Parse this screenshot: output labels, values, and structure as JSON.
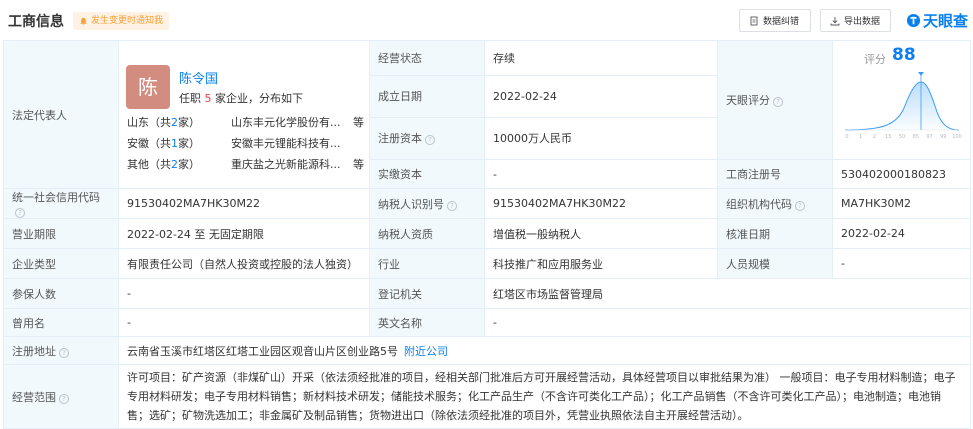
{
  "header": {
    "title": "工商信息",
    "notify_label": "发生变更时通知我",
    "error_button": "数据纠错",
    "export_button": "导出数据",
    "logo_text": "天眼查"
  },
  "rep": {
    "label": "法定代表人",
    "avatar_char": "陈",
    "name": "陈令国",
    "sub_prefix": "任职",
    "sub_count": "5",
    "sub_suffix": "家企业，分布如下",
    "groups": [
      {
        "region": "山东（共",
        "count": "2",
        "region_end": "家）",
        "company": "山东丰元化学股份有...",
        "deng": "等"
      },
      {
        "region": "安徽（共",
        "count": "1",
        "region_end": "家）",
        "company": "安徽丰元锂能科技有...",
        "deng": ""
      },
      {
        "region": "其他（共",
        "count": "2",
        "region_end": "家）",
        "company": "重庆盐之光新能源科...",
        "deng": "等"
      }
    ]
  },
  "fields": {
    "status_label": "经营状态",
    "status": "存续",
    "founded_label": "成立日期",
    "founded": "2022-02-24",
    "capital_label": "注册资本",
    "capital": "10000万人民币",
    "paid_label": "实缴资本",
    "paid": "-",
    "score_label": "天眼评分",
    "reg_no_label": "工商注册号",
    "reg_no": "530402000180823",
    "credit_label": "统一社会信用代码",
    "credit": "91530402MA7HK30M22",
    "taxpayer_id_label": "纳税人识别号",
    "taxpayer_id": "91530402MA7HK30M22",
    "org_code_label": "组织机构代码",
    "org_code": "MA7HK30M2",
    "term_label": "营业期限",
    "term": "2022-02-24  至 无固定期限",
    "tax_qual_label": "纳税人资质",
    "tax_qual": "增值税一般纳税人",
    "approve_label": "核准日期",
    "approve": "2022-02-24",
    "type_label": "企业类型",
    "type": "有限责任公司（自然人投资或控股的法人独资）",
    "industry_label": "行业",
    "industry": "科技推广和应用服务业",
    "staff_label": "人员规模",
    "staff": "-",
    "insured_label": "参保人数",
    "insured": "-",
    "authority_label": "登记机关",
    "authority": "红塔区市场监督管理局",
    "former_label": "曾用名",
    "former": "-",
    "en_name_label": "英文名称",
    "en_name": "-",
    "address_label": "注册地址",
    "address": "云南省玉溪市红塔区红塔工业园区观音山片区创业路5号",
    "nearby_link": "附近公司",
    "scope_label": "经营范围",
    "scope": "许可项目：矿产资源（非煤矿山）开采（依法须经批准的项目，经相关部门批准后方可开展经营活动，具体经营项目以审批结果为准）   一般项目：电子专用材料制造；电子专用材料研发；电子专用材料销售；新材料技术研发；储能技术服务；化工产品生产（不含许可类化工产品）；化工产品销售（不含许可类化工产品）；电池制造；电池销售；选矿；矿物洗选加工；非金属矿及制品销售；货物进出口（除依法须经批准的项目外，凭营业执照依法自主开展经营活动）。"
  },
  "score": {
    "label": "评分",
    "value": "88",
    "axis_ticks": [
      "0",
      "1",
      "2",
      "15",
      "50",
      "85",
      "97",
      "99",
      "100"
    ]
  },
  "colors": {
    "brand_blue": "#0a80f0",
    "label_bg": "#f2f9fc",
    "border": "#e4eef6",
    "notify_orange": "#f7a13a"
  }
}
